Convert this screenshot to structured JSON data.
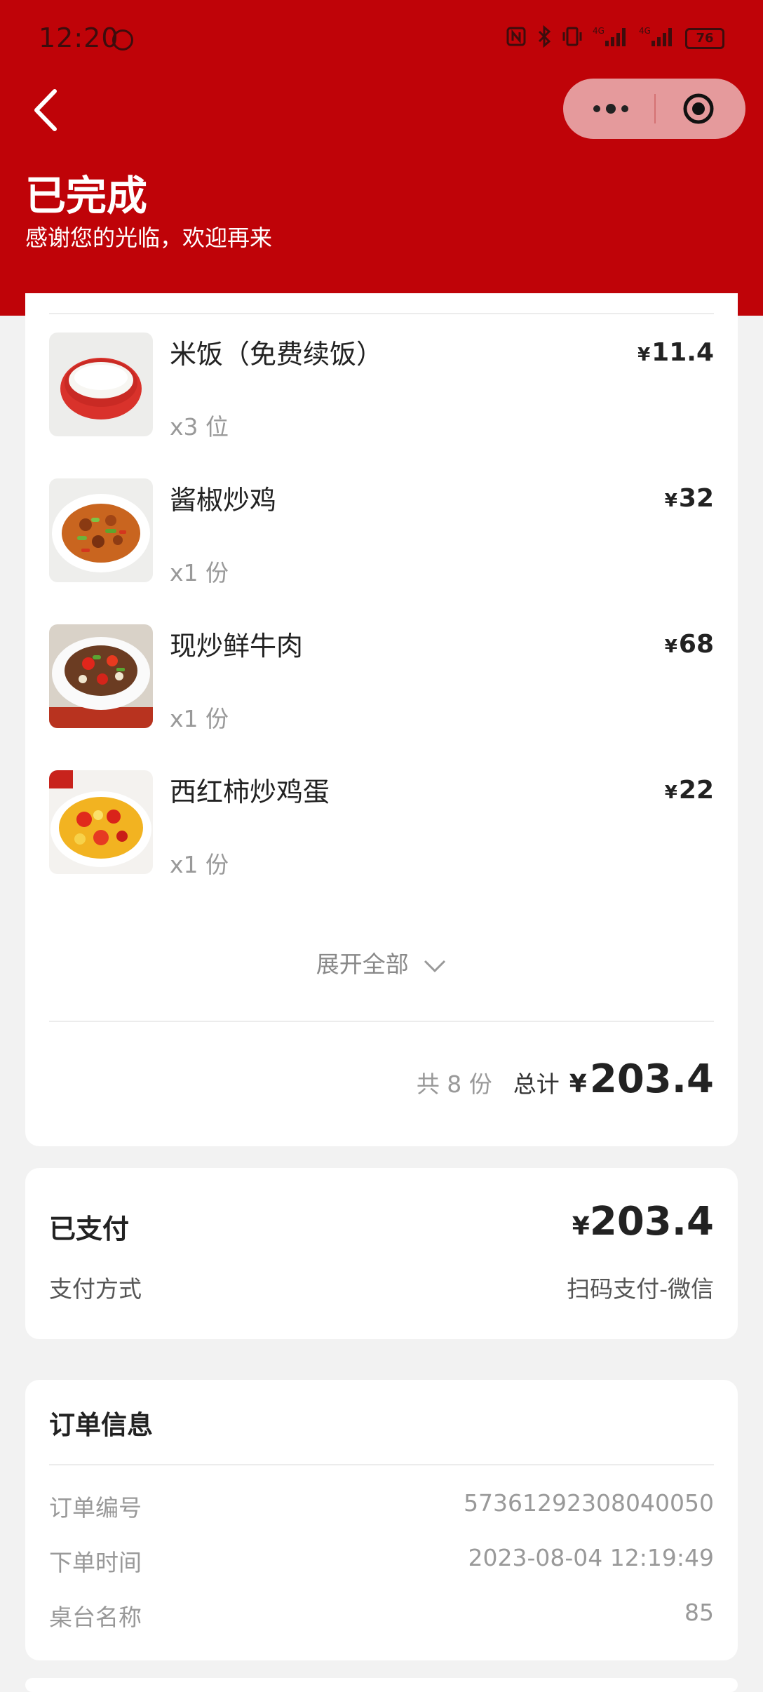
{
  "status_bar": {
    "time": "12:20",
    "battery": "76",
    "icons": [
      "nfc-icon",
      "bluetooth-icon",
      "vibrate-icon",
      "signal-4g-icon",
      "signal-4g-icon",
      "battery-icon"
    ]
  },
  "header": {
    "title": "已完成",
    "subtitle": "感谢您的光临，欢迎再来",
    "background_color": "#bf0308"
  },
  "items": [
    {
      "name": "米饭（免费续饭）",
      "qty": "x3 位",
      "currency": "¥",
      "price": "11.4"
    },
    {
      "name": "酱椒炒鸡",
      "qty": "x1 份",
      "currency": "¥",
      "price": "32"
    },
    {
      "name": "现炒鲜牛肉",
      "qty": "x1 份",
      "currency": "¥",
      "price": "68"
    },
    {
      "name": "西红柿炒鸡蛋",
      "qty": "x1 份",
      "currency": "¥",
      "price": "22"
    }
  ],
  "expand_label": "展开全部",
  "summary": {
    "count": "共 8 份",
    "total_label": "总计",
    "currency": "¥",
    "total": "203.4"
  },
  "payment": {
    "status": "已支付",
    "currency": "¥",
    "amount": "203.4",
    "method_label": "支付方式",
    "method_value": "扫码支付-微信"
  },
  "order_info": {
    "title": "订单信息",
    "rows": [
      {
        "label": "订单编号",
        "value": "57361292308040050"
      },
      {
        "label": "下单时间",
        "value": "2023-08-04 12:19:49"
      },
      {
        "label": "桌台名称",
        "value": "85"
      }
    ]
  }
}
